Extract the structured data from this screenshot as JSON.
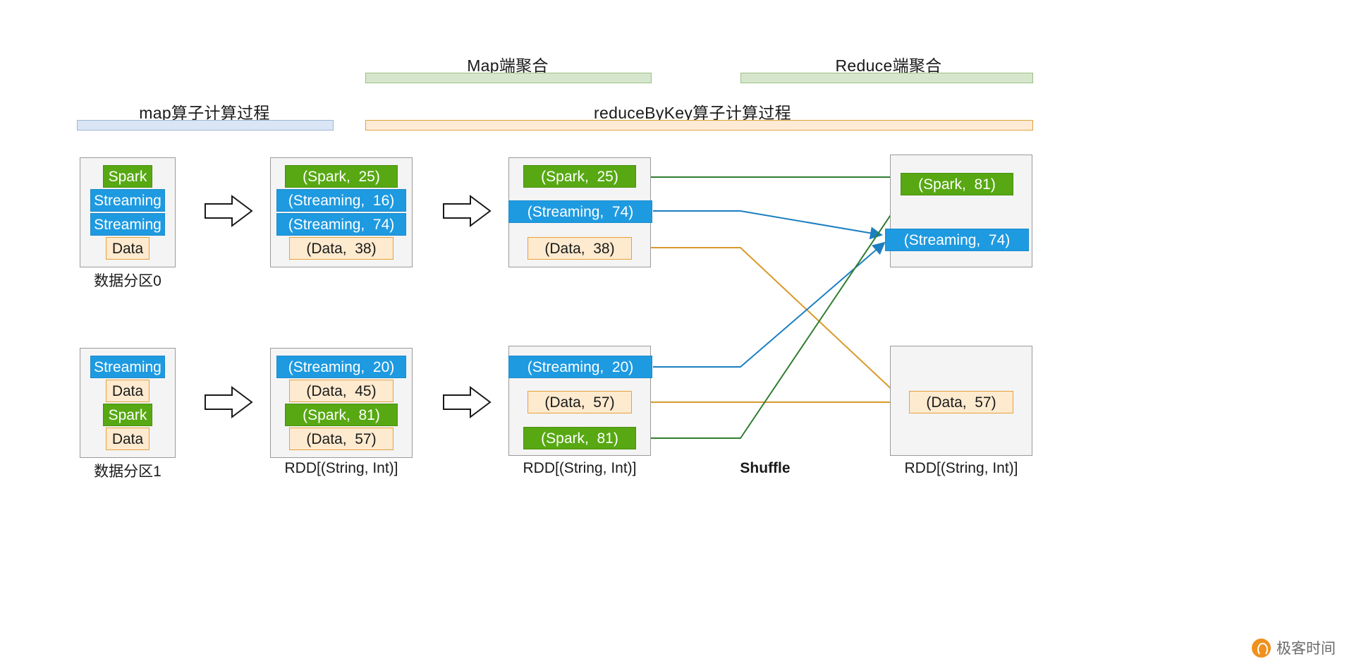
{
  "headers": [
    {
      "name": "map-stage",
      "label": "map算子计算过程",
      "bar_color": "#dae5f5"
    },
    {
      "name": "reduce-by-key-stage",
      "label": "reduceByKey算子计算过程",
      "bar_color": "#fdebd6"
    },
    {
      "name": "map-side-aggregation",
      "label": "Map端聚合",
      "bar_color": "#d6e6cd"
    },
    {
      "name": "reduce-side-aggregation",
      "label": "Reduce端聚合",
      "bar_color": "#d6e6cd"
    }
  ],
  "columns": {
    "partition0": {
      "caption": "数据分区0",
      "items": [
        {
          "text": "Spark",
          "color": "green"
        },
        {
          "text": "Streaming",
          "color": "blue"
        },
        {
          "text": "Streaming",
          "color": "blue"
        },
        {
          "text": "Data",
          "color": "orange"
        }
      ]
    },
    "partition1": {
      "caption": "数据分区1",
      "items": [
        {
          "text": "Streaming",
          "color": "blue"
        },
        {
          "text": "Data",
          "color": "orange"
        },
        {
          "text": "Spark",
          "color": "green"
        },
        {
          "text": "Data",
          "color": "orange"
        }
      ]
    },
    "mapped0": {
      "caption": "RDD[(String, Int)]",
      "items": [
        {
          "text": "(Spark,  25)",
          "color": "green"
        },
        {
          "text": "(Streaming,  16)",
          "color": "blue"
        },
        {
          "text": "(Streaming,  74)",
          "color": "blue"
        },
        {
          "text": "(Data,  38)",
          "color": "orange"
        }
      ]
    },
    "mapped1": {
      "caption": "RDD[(String, Int)]",
      "items": [
        {
          "text": "(Streaming,  20)",
          "color": "blue"
        },
        {
          "text": "(Data,  45)",
          "color": "orange"
        },
        {
          "text": "(Spark,  81)",
          "color": "green"
        },
        {
          "text": "(Data,  57)",
          "color": "orange"
        }
      ]
    },
    "aggregated0": {
      "caption": "RDD[(String, Int)]",
      "items": [
        {
          "text": "(Spark,  25)",
          "color": "green"
        },
        {
          "text": "(Streaming,  74)",
          "color": "blue"
        },
        {
          "text": "(Data,  38)",
          "color": "orange"
        }
      ]
    },
    "aggregated1": {
      "caption": "RDD[(String, Int)]",
      "items": [
        {
          "text": "(Streaming,  20)",
          "color": "blue"
        },
        {
          "text": "(Data,  57)",
          "color": "orange"
        },
        {
          "text": "(Spark,  81)",
          "color": "green"
        }
      ]
    },
    "reduced0": {
      "caption": "RDD[(String, Int)]",
      "items": [
        {
          "text": "(Spark,  81)",
          "color": "green"
        },
        {
          "text": "(Streaming,  74)",
          "color": "blue"
        }
      ]
    },
    "reduced1": {
      "caption": "",
      "items": [
        {
          "text": "(Data,  57)",
          "color": "orange"
        }
      ]
    }
  },
  "shuffle_label": "Shuffle",
  "watermark": "极客时间",
  "colors": {
    "green": "#57a812",
    "blue": "#1e9ae0",
    "orange_fill": "#fdeacf",
    "orange_border": "#e5a13c",
    "panel_bg": "#f4f4f4",
    "panel_border": "#9a9a9a"
  }
}
